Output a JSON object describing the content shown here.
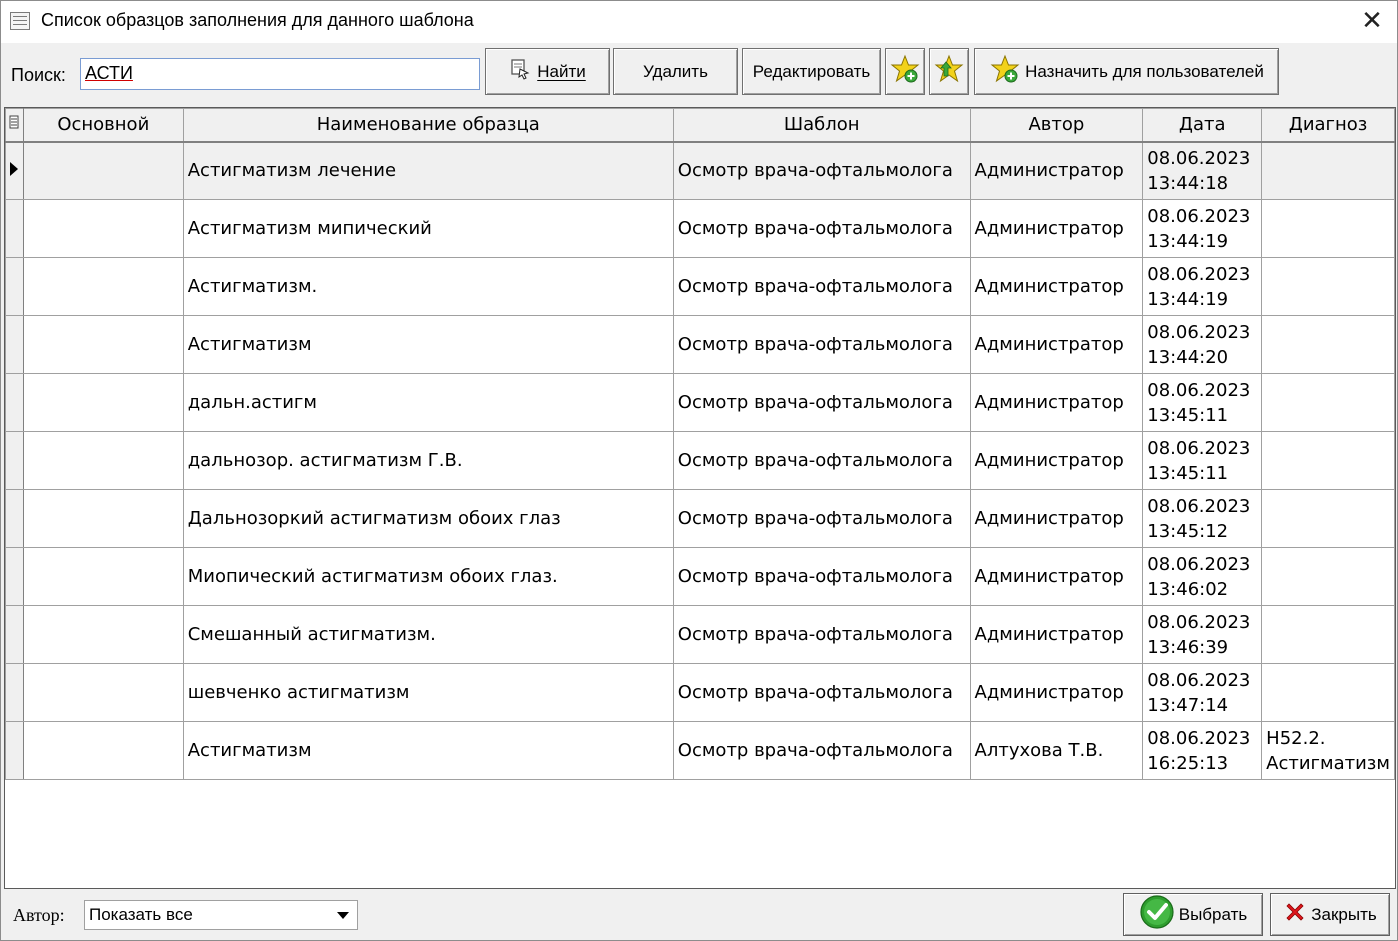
{
  "window": {
    "title": "Список образцов заполнения для данного шаблона",
    "close_glyph": "✕"
  },
  "toolbar": {
    "search_label": "Поиск:",
    "search_value": "АСТИ",
    "find_label": "Найти",
    "delete_label": "Удалить",
    "edit_label": "Редактировать",
    "assign_label": "Назначить для пользователей",
    "icons": [
      "find-icon",
      "star-add-icon",
      "star-arrow-icon",
      "star-add-users-icon"
    ]
  },
  "grid": {
    "columns": [
      "Основной",
      "Наименование образца",
      "Шаблон",
      "Автор",
      "Дата",
      "Диагноз"
    ],
    "rows": [
      {
        "main": "",
        "name": "Астигматизм лечение",
        "template": "Осмотр врача-офтальмолога",
        "author": "Администратор",
        "date": "08.06.2023",
        "time": "13:44:18",
        "diag": ""
      },
      {
        "main": "",
        "name": "Астигматизм мипический",
        "template": "Осмотр врача-офтальмолога",
        "author": "Администратор",
        "date": "08.06.2023",
        "time": "13:44:19",
        "diag": ""
      },
      {
        "main": "",
        "name": "Астигматизм.",
        "template": "Осмотр врача-офтальмолога",
        "author": "Администратор",
        "date": "08.06.2023",
        "time": "13:44:19",
        "diag": ""
      },
      {
        "main": "",
        "name": "Астигматизм",
        "template": "Осмотр врача-офтальмолога",
        "author": "Администратор",
        "date": "08.06.2023",
        "time": "13:44:20",
        "diag": ""
      },
      {
        "main": "",
        "name": "дальн.астигм",
        "template": "Осмотр врача-офтальмолога",
        "author": "Администратор",
        "date": "08.06.2023",
        "time": "13:45:11",
        "diag": ""
      },
      {
        "main": "",
        "name": "дальнозор. астигматизм Г.В.",
        "template": "Осмотр врача-офтальмолога",
        "author": "Администратор",
        "date": "08.06.2023",
        "time": "13:45:11",
        "diag": ""
      },
      {
        "main": "",
        "name": "Дальнозоркий астигматизм обоих глаз",
        "template": "Осмотр врача-офтальмолога",
        "author": "Администратор",
        "date": "08.06.2023",
        "time": "13:45:12",
        "diag": ""
      },
      {
        "main": "",
        "name": "Миопический астигматизм обоих глаз.",
        "template": "Осмотр врача-офтальмолога",
        "author": "Администратор",
        "date": "08.06.2023",
        "time": "13:46:02",
        "diag": ""
      },
      {
        "main": "",
        "name": "Смешанный астигматизм.",
        "template": "Осмотр врача-офтальмолога",
        "author": "Администратор",
        "date": "08.06.2023",
        "time": "13:46:39",
        "diag": ""
      },
      {
        "main": "",
        "name": "шевченко астигматизм",
        "template": "Осмотр врача-офтальмолога",
        "author": "Администратор",
        "date": "08.06.2023",
        "time": "13:47:14",
        "diag": ""
      },
      {
        "main": "",
        "name": "Астигматизм",
        "template": "Осмотр врача-офтальмолога",
        "author": "Алтухова Т.В.",
        "date": "08.06.2023",
        "time": "16:25:13",
        "diag": "H52.2. Астигматизм"
      }
    ],
    "selected_row": 0
  },
  "footer": {
    "author_label": "Автор:",
    "author_value": "Показать все",
    "select_label": "Выбрать",
    "close_label": "Закрыть"
  },
  "colors": {
    "check": "#2e9d2e",
    "close_x": "#e0161d",
    "star": "#f2d21b"
  }
}
